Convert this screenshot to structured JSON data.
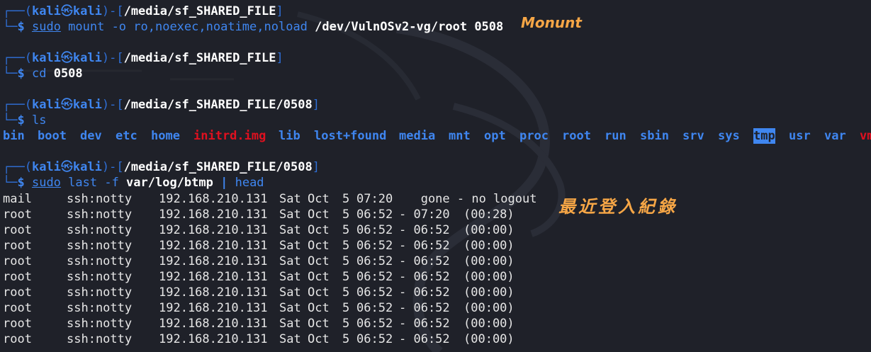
{
  "prompt": {
    "user": "kali",
    "host": "kali",
    "at_symbol": "㉿"
  },
  "blocks": [
    {
      "path": "/media/sf_SHARED_FILE",
      "cmd": "sudo",
      "rest": " mount -o ro,noexec,noatime,noload ",
      "bold_args": "/dev/VulnOSv2-vg/root 0508"
    },
    {
      "path": "/media/sf_SHARED_FILE",
      "cmd": "cd",
      "rest": " ",
      "bold_args": "0508"
    },
    {
      "path": "/media/sf_SHARED_FILE/0508",
      "cmd": "ls",
      "rest": "",
      "bold_args": ""
    },
    {
      "path": "/media/sf_SHARED_FILE/0508",
      "cmd": "sudo",
      "rest": " last -f ",
      "bold_args": "var/log/btmp",
      "pipe": " | ",
      "after_pipe": "head"
    }
  ],
  "ls_output": [
    "bin",
    "boot",
    "dev",
    "etc",
    "home",
    "initrd.img",
    "lib",
    "lost+found",
    "media",
    "mnt",
    "opt",
    "proc",
    "root",
    "run",
    "sbin",
    "srv",
    "sys",
    "tmp",
    "usr",
    "var",
    "vm"
  ],
  "last_output": [
    {
      "user": "mail",
      "tty": "ssh:notty",
      "ip": "192.168.210.131",
      "day": "Sat",
      "month": "Oct",
      "date": "5",
      "time": "07:20",
      "end": "   gone - no logout",
      "dur": ""
    },
    {
      "user": "root",
      "tty": "ssh:notty",
      "ip": "192.168.210.131",
      "day": "Sat",
      "month": "Oct",
      "date": "5",
      "time": "06:52",
      "end": "- 07:20",
      "dur": "(00:28)"
    },
    {
      "user": "root",
      "tty": "ssh:notty",
      "ip": "192.168.210.131",
      "day": "Sat",
      "month": "Oct",
      "date": "5",
      "time": "06:52",
      "end": "- 06:52",
      "dur": "(00:00)"
    },
    {
      "user": "root",
      "tty": "ssh:notty",
      "ip": "192.168.210.131",
      "day": "Sat",
      "month": "Oct",
      "date": "5",
      "time": "06:52",
      "end": "- 06:52",
      "dur": "(00:00)"
    },
    {
      "user": "root",
      "tty": "ssh:notty",
      "ip": "192.168.210.131",
      "day": "Sat",
      "month": "Oct",
      "date": "5",
      "time": "06:52",
      "end": "- 06:52",
      "dur": "(00:00)"
    },
    {
      "user": "root",
      "tty": "ssh:notty",
      "ip": "192.168.210.131",
      "day": "Sat",
      "month": "Oct",
      "date": "5",
      "time": "06:52",
      "end": "- 06:52",
      "dur": "(00:00)"
    },
    {
      "user": "root",
      "tty": "ssh:notty",
      "ip": "192.168.210.131",
      "day": "Sat",
      "month": "Oct",
      "date": "5",
      "time": "06:52",
      "end": "- 06:52",
      "dur": "(00:00)"
    },
    {
      "user": "root",
      "tty": "ssh:notty",
      "ip": "192.168.210.131",
      "day": "Sat",
      "month": "Oct",
      "date": "5",
      "time": "06:52",
      "end": "- 06:52",
      "dur": "(00:00)"
    },
    {
      "user": "root",
      "tty": "ssh:notty",
      "ip": "192.168.210.131",
      "day": "Sat",
      "month": "Oct",
      "date": "5",
      "time": "06:52",
      "end": "- 06:52",
      "dur": "(00:00)"
    },
    {
      "user": "root",
      "tty": "ssh:notty",
      "ip": "192.168.210.131",
      "day": "Sat",
      "month": "Oct",
      "date": "5",
      "time": "06:52",
      "end": "- 06:52",
      "dur": "(00:00)"
    }
  ],
  "annotations": {
    "mount_note": "Monunt",
    "login_note": "最近登入紀錄"
  },
  "colors": {
    "background": "#1f2129",
    "prompt_blue": "#3f86f0",
    "frame_blue": "#2f6fd6",
    "highlight_red": "#e0101f",
    "annotation_orange": "#f6a646"
  }
}
